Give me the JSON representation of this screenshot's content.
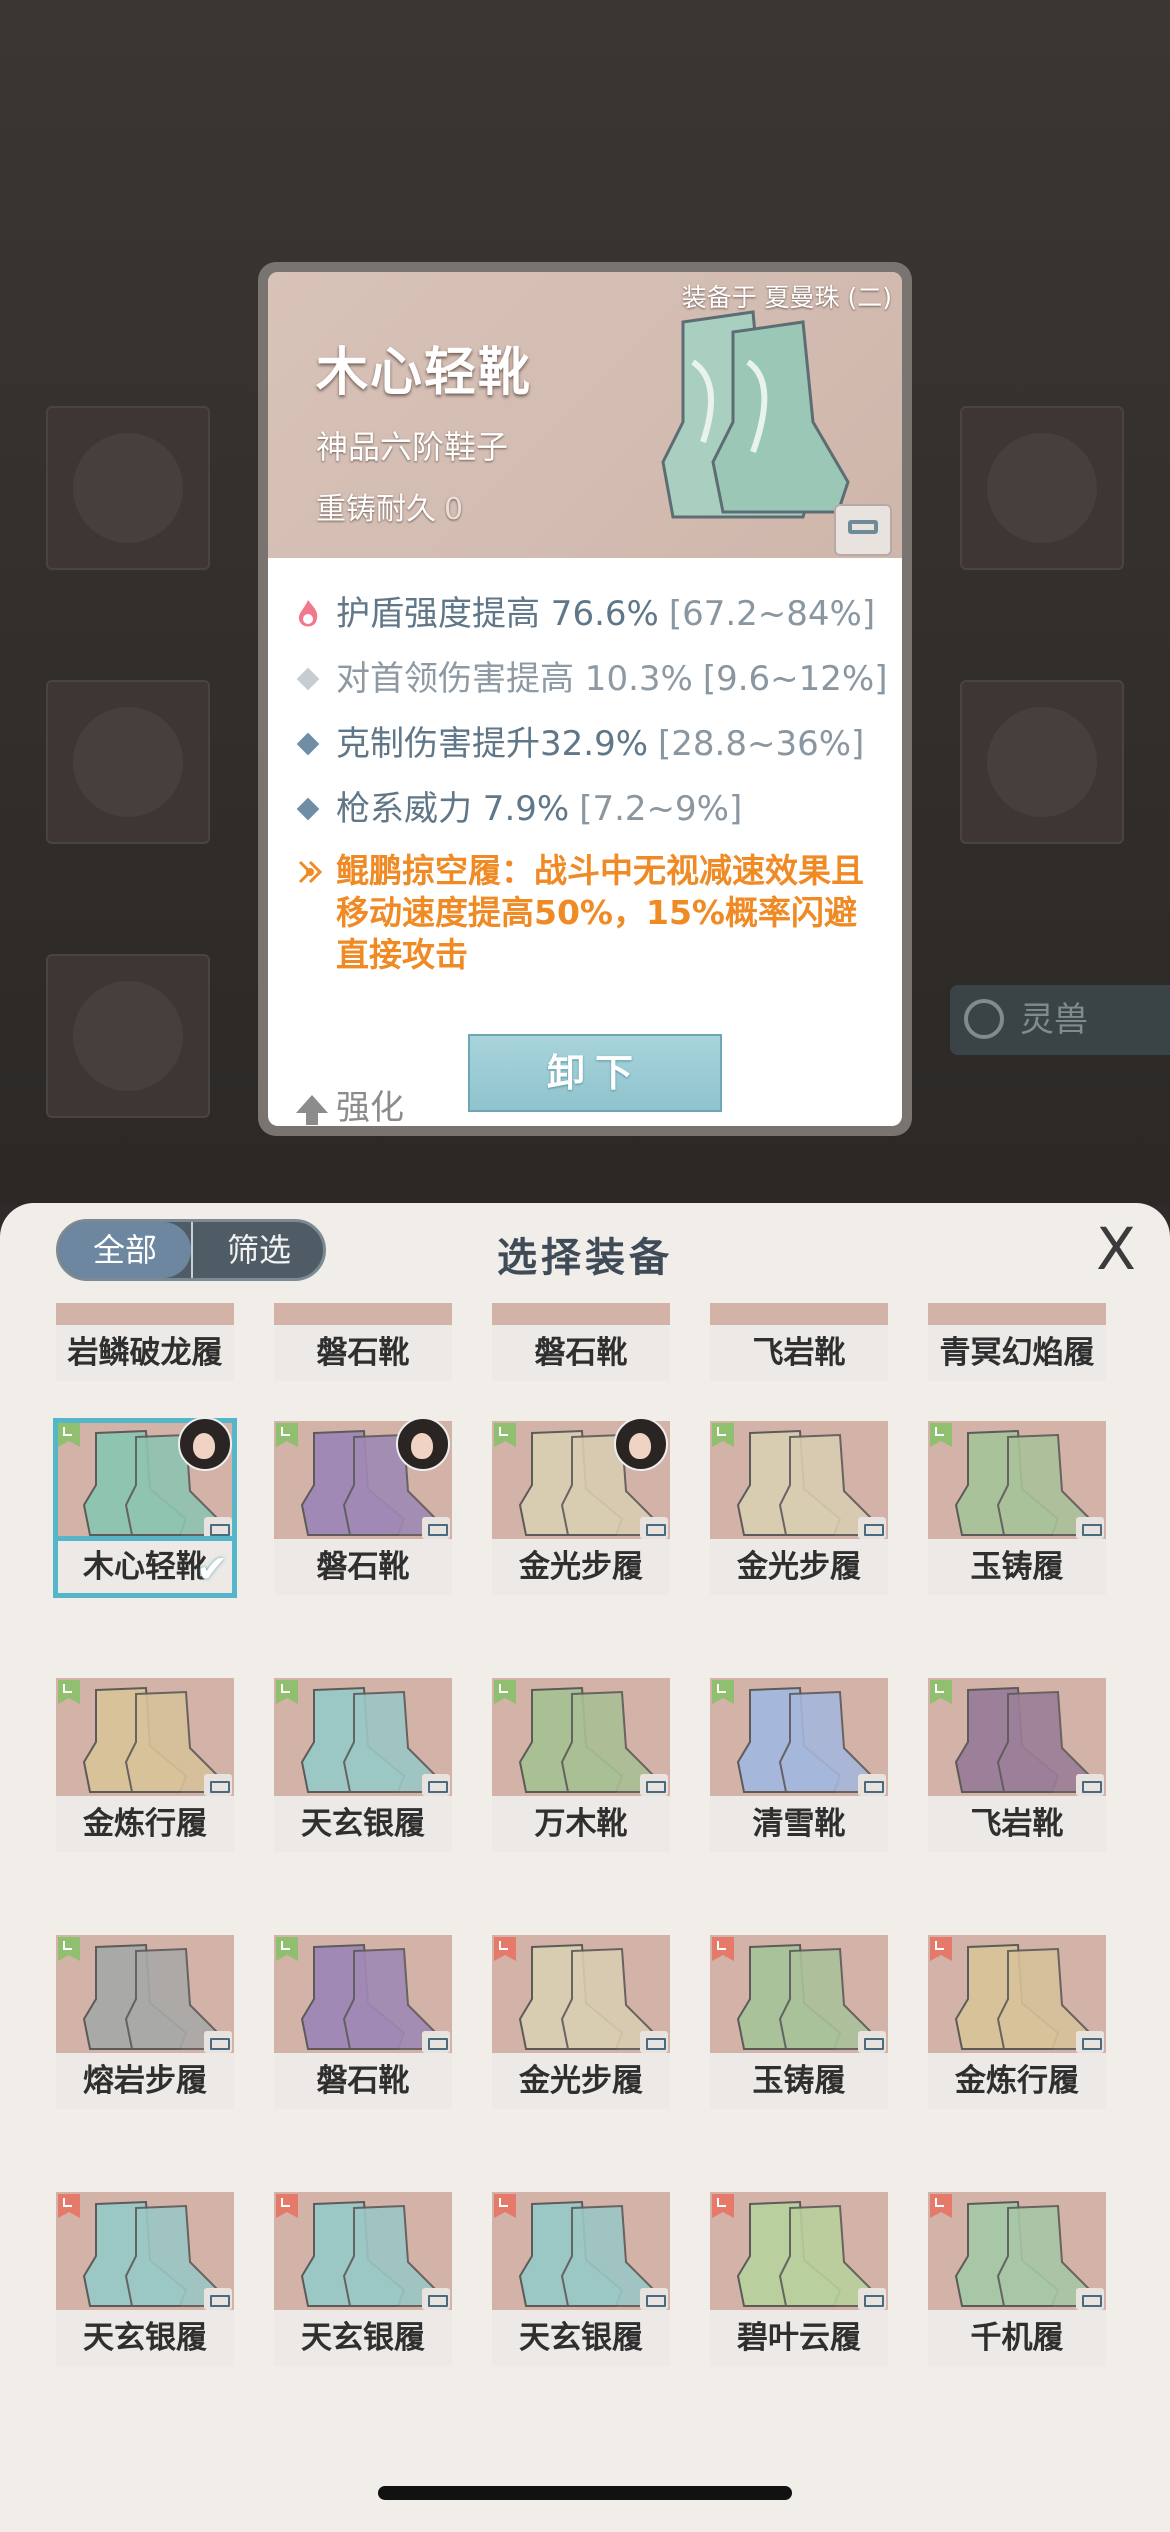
{
  "background": {
    "side_tab_label": "灵兽"
  },
  "card": {
    "equipped_to": "装备于 夏曼珠 (二)",
    "name": "木心轻靴",
    "grade": "神品六阶鞋子",
    "recast_label": "重铸耐久",
    "recast_value": "0",
    "stats": [
      {
        "text": "护盾强度提高 76.6%",
        "range": "[67.2~84%]",
        "style": "flame"
      },
      {
        "text": "对首领伤害提高 10.3%",
        "range": "[9.6~12%]",
        "style": "gray"
      },
      {
        "text": "克制伤害提升32.9%",
        "range": "[28.8~36%]",
        "style": "blue"
      },
      {
        "text": "枪系威力 7.9%",
        "range": "[7.2~9%]",
        "style": "blue"
      }
    ],
    "special_effect": "鲲鹏掠空履：战斗中无视减速效果且移动速度提高50%，15%概率闪避直接攻击",
    "enhance_label": "强化",
    "unequip_label": "卸下"
  },
  "panel": {
    "tab_all": "全部",
    "tab_filter": "筛选",
    "title": "选择装备",
    "close_symbol": "X",
    "top_row": [
      "岩鳞破龙履",
      "磐石靴",
      "磐石靴",
      "飞岩靴",
      "青冥幻焰履"
    ],
    "rows": [
      [
        {
          "name": "木心轻靴",
          "color": "#8fc4b1",
          "tag": "#8fbf6f",
          "selected": true,
          "avatar": true
        },
        {
          "name": "磐石靴",
          "color": "#a08ab5",
          "tag": "#8fbf6f",
          "avatar": true
        },
        {
          "name": "金光步履",
          "color": "#d9cdb1",
          "tag": "#8fbf6f",
          "avatar": true
        },
        {
          "name": "金光步履",
          "color": "#d9cdb1",
          "tag": "#8fbf6f"
        },
        {
          "name": "玉铸履",
          "color": "#a9c29a",
          "tag": "#8fbf6f"
        }
      ],
      [
        {
          "name": "金炼行履",
          "color": "#d7c29a",
          "tag": "#8fbf6f"
        },
        {
          "name": "天玄银履",
          "color": "#9bc7c4",
          "tag": "#8fbf6f"
        },
        {
          "name": "万木靴",
          "color": "#a9bf94",
          "tag": "#8fbf6f"
        },
        {
          "name": "清雪靴",
          "color": "#a6b7dc",
          "tag": "#8fbf6f"
        },
        {
          "name": "飞岩靴",
          "color": "#9c7f98",
          "tag": "#8fbf6f"
        }
      ],
      [
        {
          "name": "熔岩步履",
          "color": "#a9a9a7",
          "tag": "#8fbf6f"
        },
        {
          "name": "磐石靴",
          "color": "#a08ab5",
          "tag": "#8fbf6f"
        },
        {
          "name": "金光步履",
          "color": "#d9cdb1",
          "tag": "#e57a6b"
        },
        {
          "name": "玉铸履",
          "color": "#a9c29a",
          "tag": "#e57a6b"
        },
        {
          "name": "金炼行履",
          "color": "#d7c29a",
          "tag": "#e57a6b"
        }
      ],
      [
        {
          "name": "天玄银履",
          "color": "#9bc7c4",
          "tag": "#e57a6b"
        },
        {
          "name": "天玄银履",
          "color": "#9bc7c4",
          "tag": "#e57a6b"
        },
        {
          "name": "天玄银履",
          "color": "#9bc7c4",
          "tag": "#e57a6b"
        },
        {
          "name": "碧叶云履",
          "color": "#b9cf9d",
          "tag": "#e57a6b"
        },
        {
          "name": "千机履",
          "color": "#a7c7a6",
          "tag": "#e57a6b"
        }
      ]
    ]
  }
}
